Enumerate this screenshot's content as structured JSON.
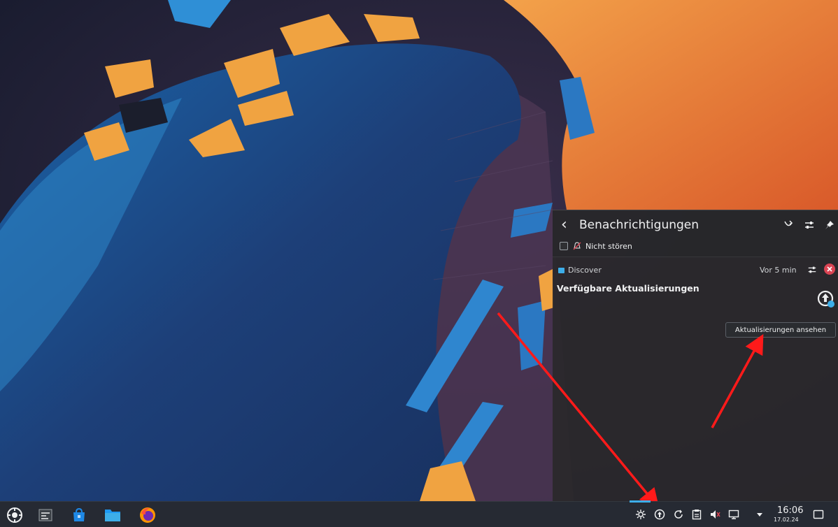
{
  "notifications": {
    "title": "Benachrichtigungen",
    "dnd_label": "Nicht stören",
    "items": [
      {
        "app_name": "Discover",
        "time": "Vor 5 min",
        "title": "Verfügbare Aktualisierungen",
        "action_tooltip": "Aktualisierungen ansehen"
      }
    ]
  },
  "panel": {
    "clock_time": "16:06",
    "clock_date": "17.02.24",
    "launchers": [
      "application-launcher-icon",
      "task-manager-icon",
      "discover-store-icon",
      "file-manager-icon",
      "firefox-icon"
    ],
    "tray": [
      "settings-gear-icon",
      "update-notifier-icon",
      "sync-icon",
      "clipboard-icon",
      "volume-muted-icon",
      "display-icon",
      "tray-expander-icon"
    ]
  },
  "colors": {
    "accent": "#3daee9",
    "panel_bg": "#262a33",
    "popup_bg": "#2a282c",
    "close_red": "#da4453",
    "arrow_red": "#ff1a1a"
  }
}
